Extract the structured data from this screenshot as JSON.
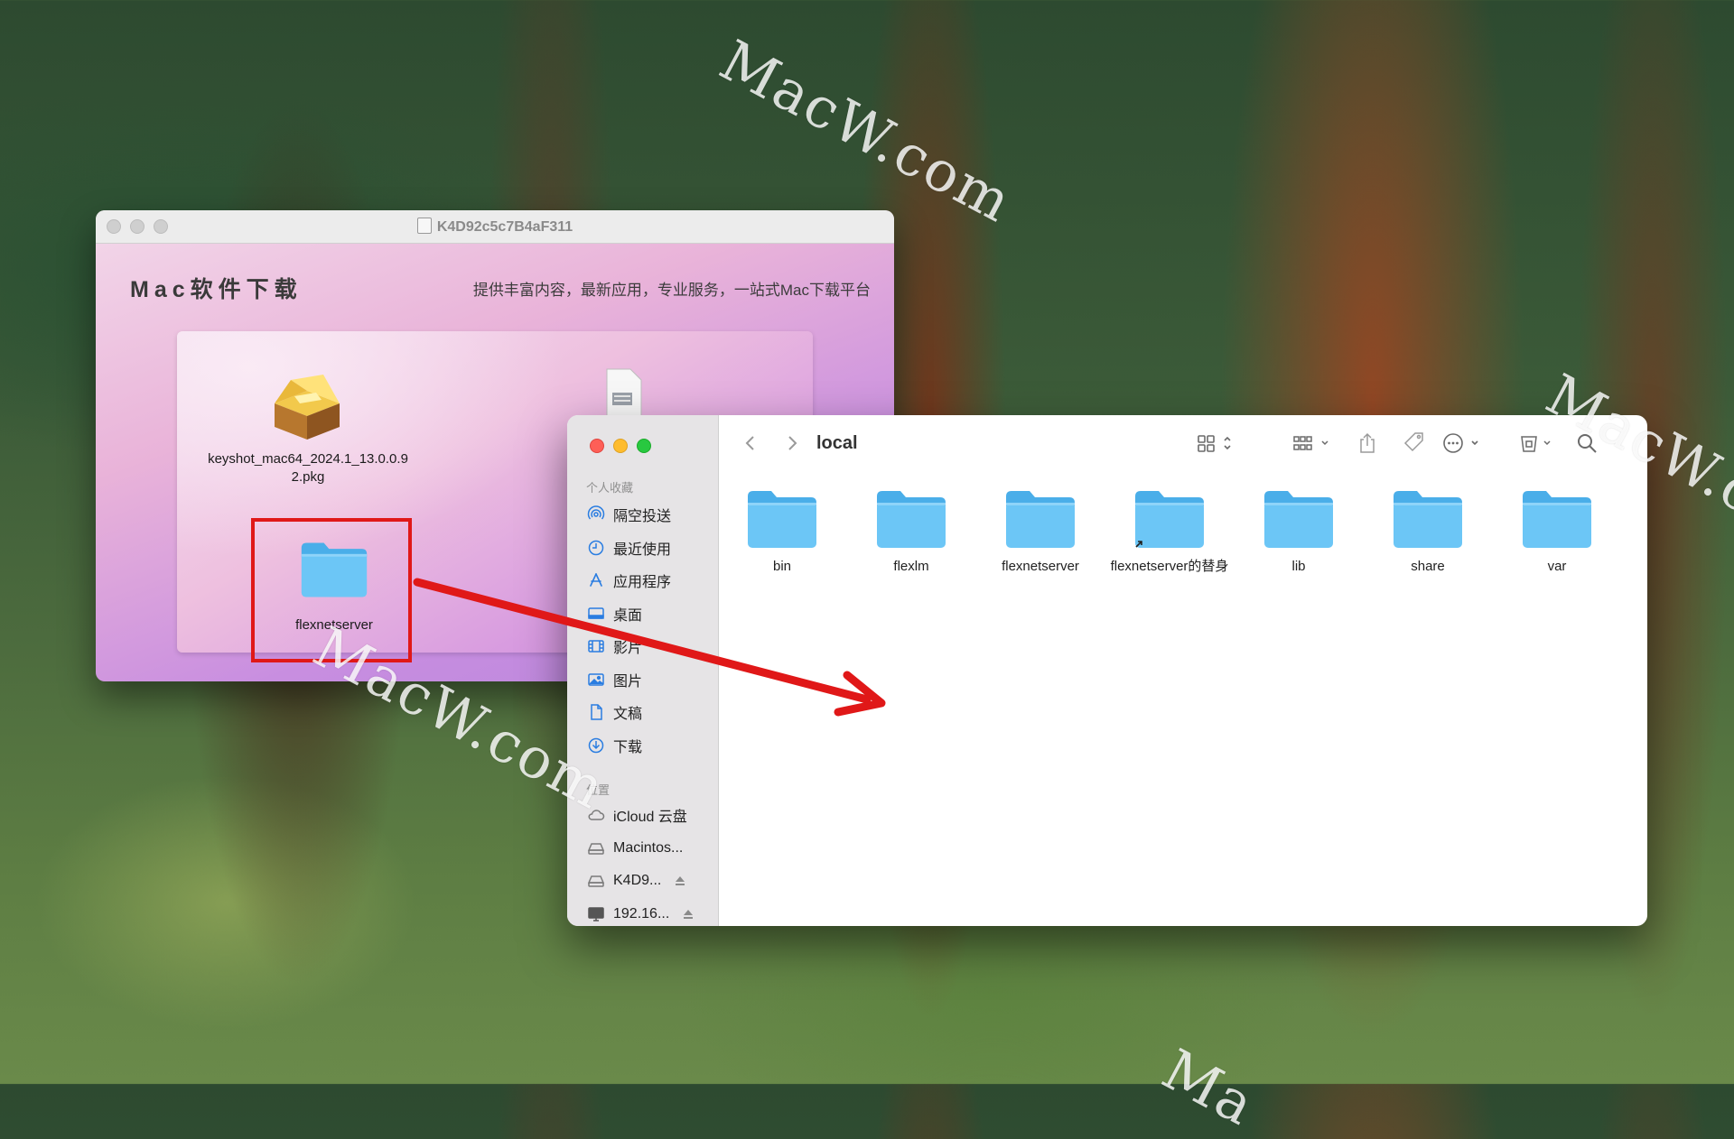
{
  "dmg_window": {
    "title": "K4D92c5c7B4aF311",
    "brand": "Mac软件下载",
    "tagline": "提供丰富内容，最新应用，专业服务，一站式Mac下载平台",
    "items": [
      {
        "label": "keyshot_mac64_2024.1_13.0.0.92.pkg",
        "icon": "package-icon"
      },
      {
        "label": "flexnetserver",
        "icon": "folder-icon"
      }
    ]
  },
  "finder": {
    "title": "local",
    "sidebar": {
      "favorites_title": "个人收藏",
      "favorites": [
        {
          "label": "隔空投送",
          "icon": "airdrop-icon"
        },
        {
          "label": "最近使用",
          "icon": "clock-icon"
        },
        {
          "label": "应用程序",
          "icon": "applications-icon"
        },
        {
          "label": "桌面",
          "icon": "desktop-icon"
        },
        {
          "label": "影片",
          "icon": "film-icon"
        },
        {
          "label": "图片",
          "icon": "photo-icon"
        },
        {
          "label": "文稿",
          "icon": "document-icon"
        },
        {
          "label": "下载",
          "icon": "download-icon"
        }
      ],
      "locations_title": "位置",
      "locations": [
        {
          "label": "iCloud 云盘",
          "icon": "cloud-icon"
        },
        {
          "label": "Macintos...",
          "icon": "disk-icon"
        },
        {
          "label": "K4D9...",
          "icon": "disk-icon"
        },
        {
          "label": "192.16...",
          "icon": "display-icon"
        }
      ]
    },
    "items": [
      {
        "label": "bin"
      },
      {
        "label": "flexlm"
      },
      {
        "label": "flexnetserver"
      },
      {
        "label": "flexnetserver的替身"
      },
      {
        "label": "lib"
      },
      {
        "label": "share"
      },
      {
        "label": "var"
      }
    ]
  },
  "watermarks": [
    "MacW.com",
    "MacW.com",
    "MacW.com",
    "Ma"
  ],
  "colors": {
    "highlight": "#e01818",
    "arrow": "#e01818",
    "folder": "#5bbcf1"
  }
}
